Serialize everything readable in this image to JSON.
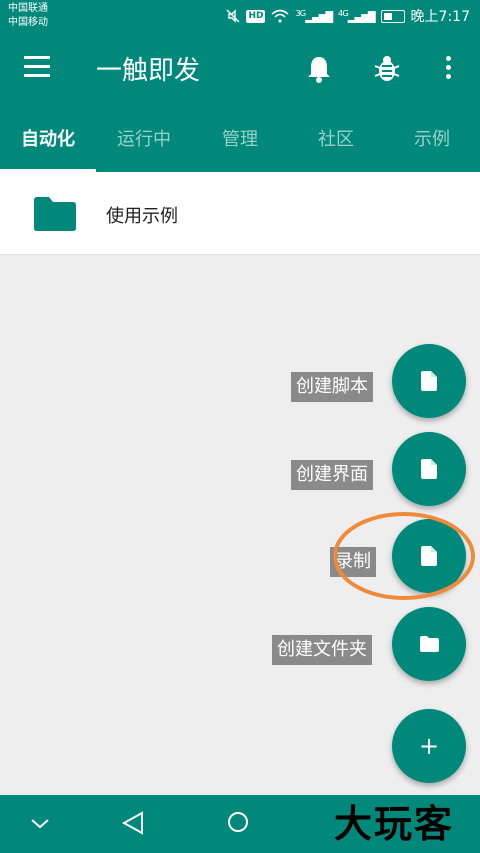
{
  "status_bar": {
    "carrier_1": "中国联通",
    "carrier_2": "中国移动",
    "hd": "HD",
    "net_3g": "3G",
    "net_4g": "4G",
    "time": "晚上7:17"
  },
  "app_bar": {
    "title": "一触即发"
  },
  "tabs": [
    {
      "label": "自动化",
      "active": true
    },
    {
      "label": "运行中",
      "active": false
    },
    {
      "label": "管理",
      "active": false
    },
    {
      "label": "社区",
      "active": false
    },
    {
      "label": "示例",
      "active": false
    }
  ],
  "list": {
    "items": [
      {
        "label": "使用示例",
        "icon": "folder-icon"
      }
    ]
  },
  "fab_menu": {
    "create_script": "创建脚本",
    "create_ui": "创建界面",
    "record": "录制",
    "create_folder": "创建文件夹",
    "main_icon": "+"
  },
  "watermark": "大玩客",
  "colors": {
    "primary": "#00897b",
    "fab_label_bg": "#8a8a8a",
    "highlight": "#ef8a3a"
  }
}
